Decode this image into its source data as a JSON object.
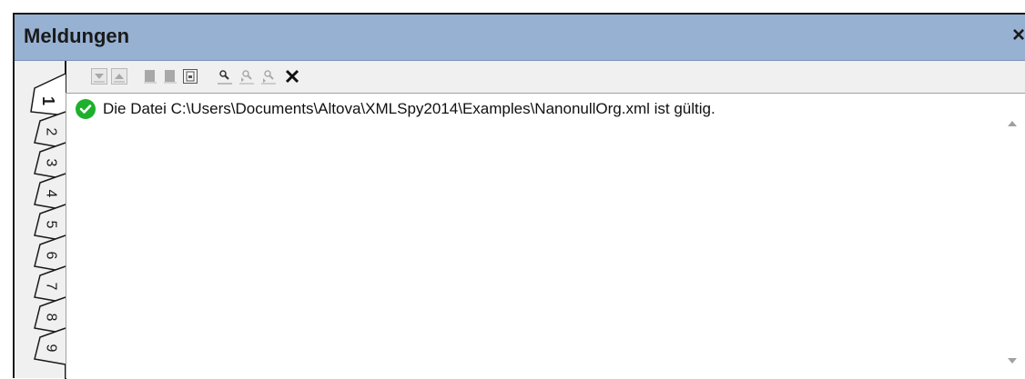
{
  "window": {
    "title": "Meldungen",
    "close_glyph": "×"
  },
  "tabs": [
    "1",
    "2",
    "3",
    "4",
    "5",
    "6",
    "7",
    "8",
    "9"
  ],
  "active_tab": "1",
  "toolbar": {
    "buttons": [
      "next-message-icon",
      "previous-message-icon",
      "copy-message-icon",
      "copy-all-messages-icon",
      "copy-all-icon",
      "find-icon",
      "find-previous-icon",
      "find-next-icon",
      "clear-icon"
    ]
  },
  "messages": [
    {
      "status": "valid",
      "icon": "check-circle-icon",
      "text": "Die Datei C:\\Users\\Documents\\Altova\\XMLSpy2014\\Examples\\NanonullOrg.xml ist gültig."
    }
  ],
  "colors": {
    "titlebar": "#97b1d3",
    "ok_green": "#1db02b",
    "panel": "#f0f0f0"
  }
}
